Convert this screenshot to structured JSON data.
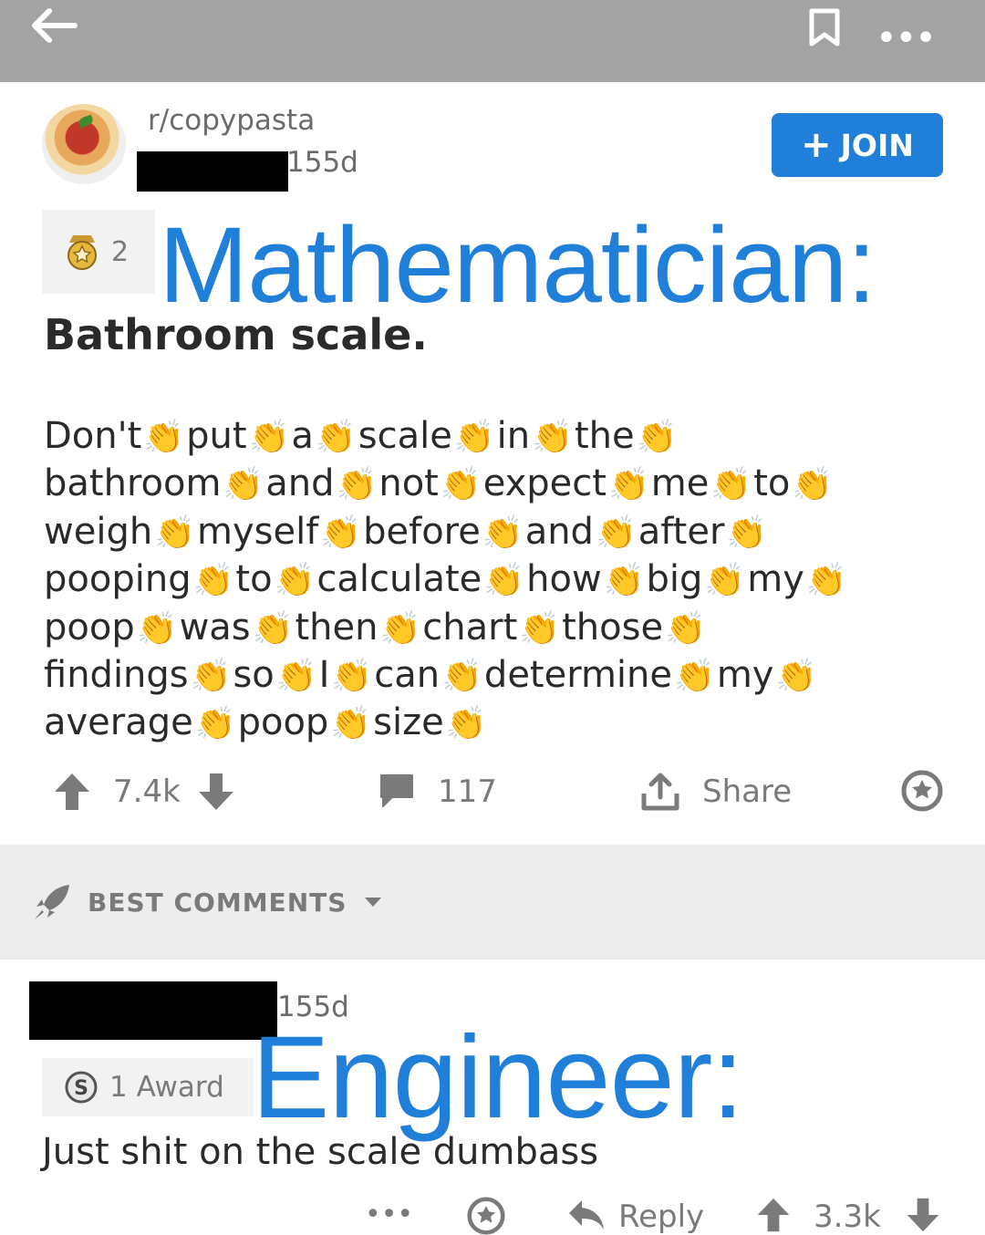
{
  "topbar": {
    "back_icon": "arrow-left-icon",
    "bookmark_icon": "bookmark-icon",
    "more_label": "•••"
  },
  "post": {
    "subreddit": "r/copypasta",
    "age": "155d",
    "join_label": "JOIN",
    "award_count": "2",
    "overlay_title": "Mathematician:",
    "title": "Bathroom scale.",
    "body_lines": [
      [
        "Don't",
        "put",
        "a",
        "scale",
        "in",
        "the"
      ],
      [
        "bathroom",
        "and",
        "not",
        "expect",
        "me",
        "to"
      ],
      [
        "weigh",
        "myself",
        "before",
        "and",
        "after"
      ],
      [
        "pooping",
        "to",
        "calculate",
        "how",
        "big",
        "my"
      ],
      [
        "poop",
        "was",
        "then",
        "chart",
        "those"
      ],
      [
        "findings",
        "so",
        "I",
        "can",
        "determine",
        "my"
      ],
      [
        "average",
        "poop",
        "size"
      ]
    ],
    "clap_emoji": "👏",
    "upvotes": "7.4k",
    "comments": "117",
    "share_label": "Share"
  },
  "sort": {
    "label": "BEST COMMENTS"
  },
  "comment": {
    "age": "155d",
    "award_label": "1 Award",
    "overlay_title": "Engineer:",
    "text": "Just shit on the scale dumbass",
    "more_label": "•••",
    "reply_label": "Reply",
    "upvotes": "3.3k"
  },
  "colors": {
    "accent": "#1f7fd9",
    "topbar": "#a3a3a3",
    "muted": "#7a7a7a",
    "separator": "#ededed"
  }
}
